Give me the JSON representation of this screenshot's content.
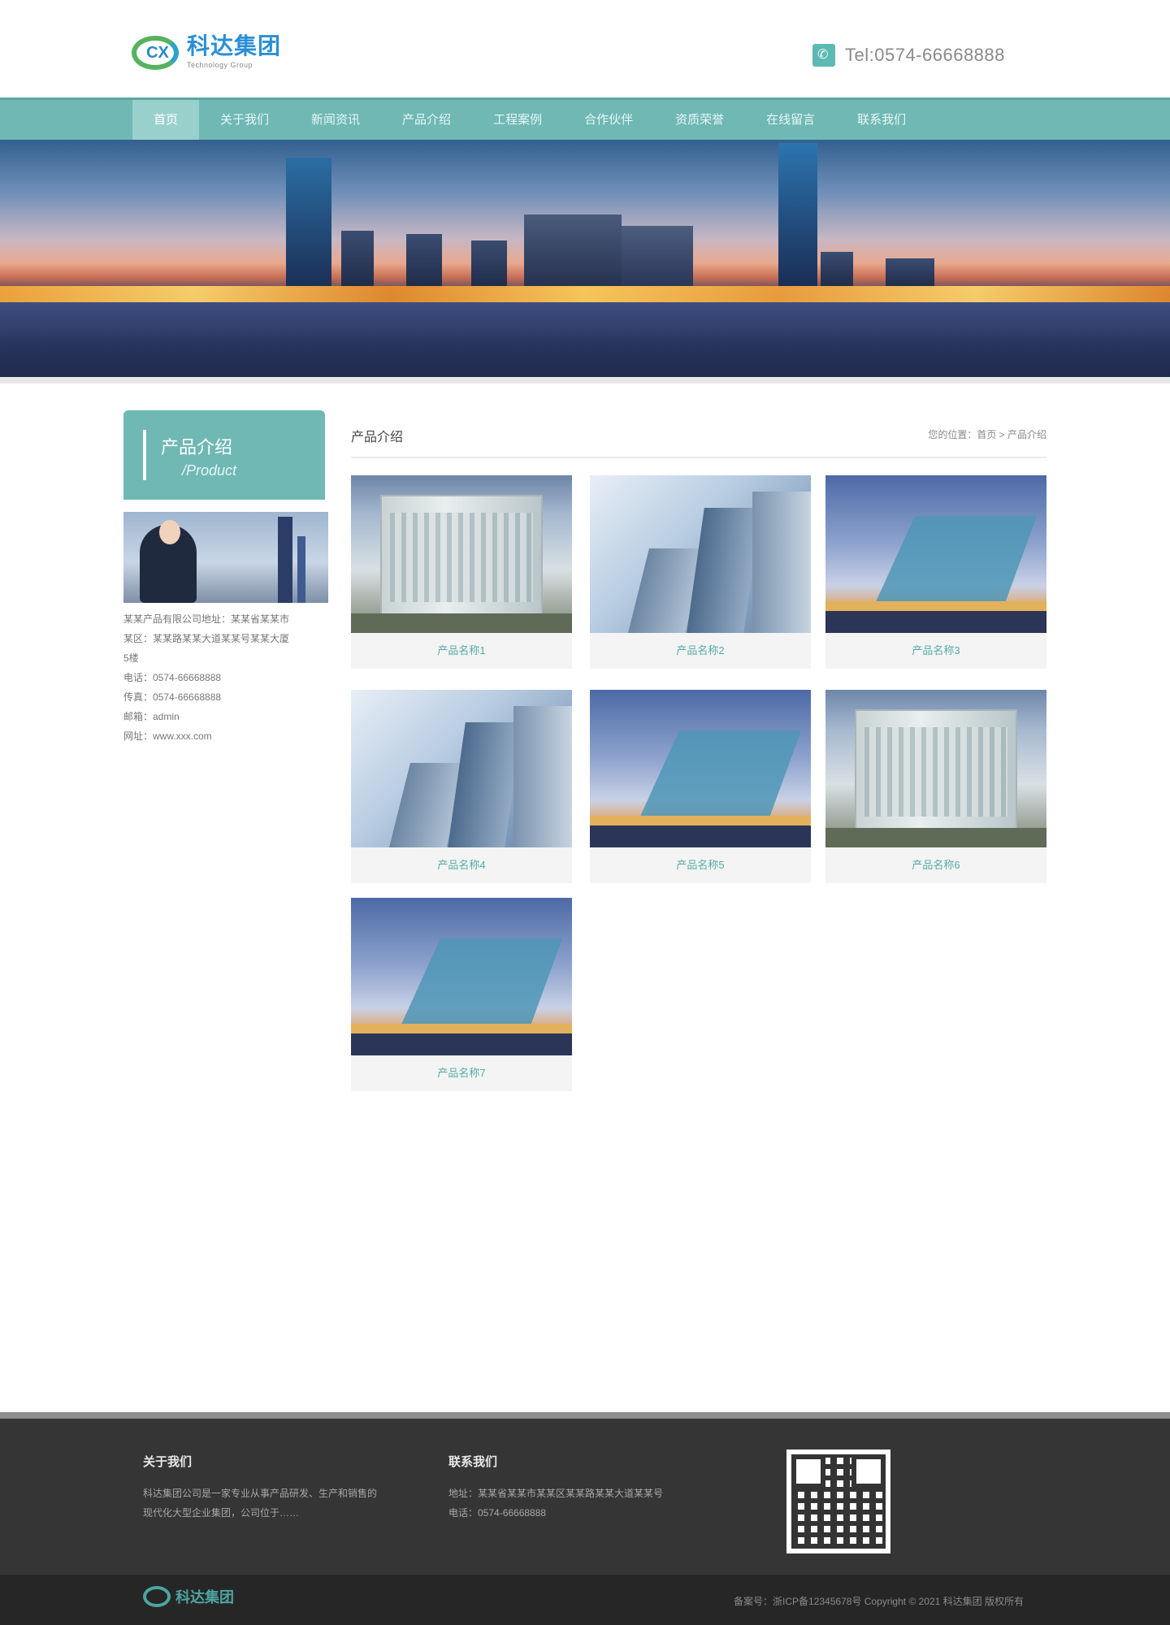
{
  "header": {
    "logo_cn": "科达集团",
    "logo_en": "Technology Group",
    "tel": "Tel:0574-66668888"
  },
  "nav": {
    "items": [
      "首页",
      "关于我们",
      "新闻资讯",
      "产品介绍",
      "工程案例",
      "合作伙伴",
      "资质荣誉",
      "在线留言",
      "联系我们"
    ]
  },
  "sidebar": {
    "title_cn": "产品介绍",
    "title_en": "/Product",
    "contact": [
      "某某产品有限公司地址：某某省某某市",
      "某区：某某路某某大道某某号某某大厦",
      "5楼",
      "电话：0574-66668888",
      "传真：0574-66668888",
      "邮箱：admin",
      "网址：www.xxx.com"
    ]
  },
  "main": {
    "title": "产品介绍",
    "breadcrumb": "您的位置：首页 > 产品介绍",
    "products": [
      {
        "name": "产品名称1",
        "pic": "office"
      },
      {
        "name": "产品名称2",
        "pic": "glass"
      },
      {
        "name": "产品名称3",
        "pic": "bridge"
      },
      {
        "name": "产品名称4",
        "pic": "glass"
      },
      {
        "name": "产品名称5",
        "pic": "bridge"
      },
      {
        "name": "产品名称6",
        "pic": "office"
      },
      {
        "name": "产品名称7",
        "pic": "bridge"
      }
    ]
  },
  "footer": {
    "about_title": "关于我们",
    "about_text": [
      "科达集团公司是一家专业从事产品研发、生产和销售的",
      "现代化大型企业集团，公司位于……"
    ],
    "contact_title": "联系我们",
    "contact_text": [
      "地址：某某省某某市某某区某某路某某大道某某号",
      "电话：0574-66668888"
    ],
    "bottom_logo": "科达集团",
    "copyright": "备案号：浙ICP备12345678号    Copyright © 2021 科达集团 版权所有"
  }
}
